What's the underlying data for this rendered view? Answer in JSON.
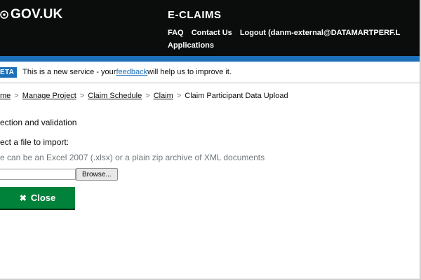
{
  "header": {
    "logo_text": "GOV.UK",
    "service_name": "E-CLAIMS",
    "nav": {
      "faq": "FAQ",
      "contact": "Contact Us",
      "logout": "Logout (danm-external@DATAMARTPERF.L",
      "applications": "Applications"
    }
  },
  "colors": {
    "header_bg": "#0b0c0c",
    "accent_blue": "#1d70b8",
    "button_green": "#00823b"
  },
  "beta": {
    "tag": "ETA",
    "text_before": "This is a new service - your ",
    "link": "feedback",
    "text_after": " will help us to improve it."
  },
  "breadcrumb": {
    "items": [
      "me",
      "Manage Project",
      "Claim Schedule",
      "Claim"
    ],
    "current": "Claim Participant Data Upload",
    "separator": ">"
  },
  "main": {
    "section_title": "ection and validation",
    "select_label": "ect a file to import:",
    "hint": "e can be an Excel 2007 (.xlsx) or a plain zip archive of XML documents",
    "file_value": "",
    "browse_label": "Browse...",
    "close_label": "Close",
    "close_icon": "close-icon"
  }
}
